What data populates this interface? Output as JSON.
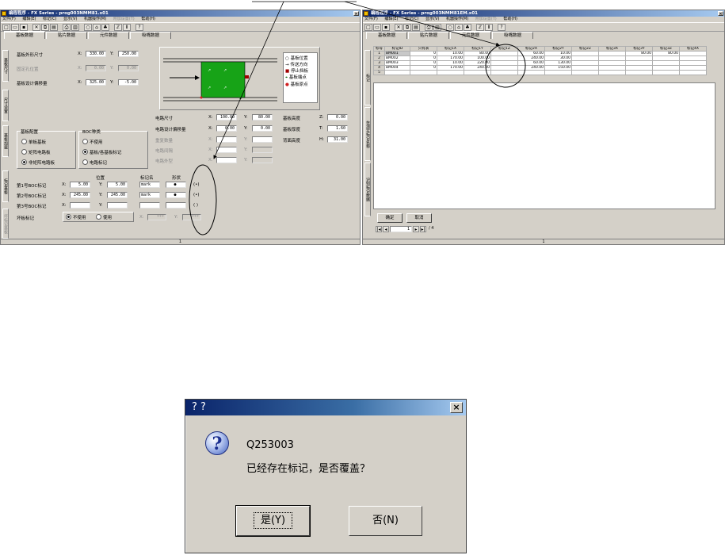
{
  "left_window": {
    "title": "编程程序 - FX Series - prog003NMM81.x01",
    "menu": [
      "文件(F)",
      "编辑(E)",
      "标记(C)",
      "显示(V)",
      "机器操作(M)",
      "附加设置(T)",
      "帮助(H)"
    ],
    "menu_disabled_index": 5,
    "toolbar_icons": [
      "new-icon",
      "open-icon",
      "save-icon",
      "cut-icon",
      "copy-icon",
      "paste-icon",
      "print-icon",
      "preview-icon",
      "bulb-icon",
      "machine-icon",
      "tree-icon",
      "table-icon",
      "grid-icon",
      "help-icon"
    ],
    "tabs": [
      "基板数据",
      "贴片数据",
      "元件数据",
      "吸嘴数据"
    ],
    "vtabs": [
      "基板尺寸",
      "尺寸设置",
      "基板加载",
      "标记基板",
      "坏标记基板"
    ],
    "board_outline_label": "基板外形尺寸",
    "board_outline_x": "330.00",
    "board_outline_y": "250.00",
    "fixed_pos_label": "固定孔位置",
    "fixed_pos_x": "0.00",
    "fixed_pos_y": "0.00",
    "board_offset_label": "基板设计偏移量",
    "board_offset_x": "325.00",
    "board_offset_y": "-5.00",
    "legend": [
      "基板位置",
      "传送方向",
      "停止挡板",
      "基板端点",
      "基板原点"
    ],
    "circuit_size_label": "电路尺寸",
    "circuit_size_x": "100.00",
    "circuit_size_y": "80.00",
    "circuit_offset_label": "电路设计偏移量",
    "circuit_offset_x": "0.00",
    "circuit_offset_y": "0.00",
    "repeat_label": "重复数量",
    "pitch_label": "电路间隔",
    "pattern_label": "电路外型",
    "board_height_label": "基板高度",
    "board_height_value": "0.00",
    "board_thickness_label": "基板厚度",
    "board_thickness_value": "1.60",
    "support_height_label": "背面高度",
    "support_height_value": "31.00",
    "board_config_label": "基板配置",
    "board_config_options": [
      "单板基板",
      "矩阵电路板",
      "非矩阵电路板"
    ],
    "bad_mark_label": "BOC种类",
    "bad_mark_options": [
      "不使用",
      "基板/各基板标记",
      "电路标记"
    ],
    "mark_header_pos": "位置",
    "mark_header_name": "标记名",
    "mark_header_shape": "形状",
    "mark_rows": [
      {
        "label": "第1号BOC标记",
        "x": "5.00",
        "y": "5.00",
        "name": "mark"
      },
      {
        "label": "第2号BOC标记",
        "x": "245.00",
        "y": "245.00",
        "name": "mark"
      },
      {
        "label": "第3号BOC标记",
        "x": "",
        "y": "",
        "name": ""
      }
    ],
    "bad_mark_row_label": "坏板标记",
    "bad_mark_row_options": [
      "不使用",
      "使用"
    ],
    "bad_mark_row_x": "***",
    "bad_mark_row_y": "***",
    "status": "1"
  },
  "right_window": {
    "title": "编程程序 - FX Series - prog003NMM81EM.x01",
    "menu": [
      "文件(F)",
      "编辑(E)",
      "标记(C)",
      "显示(V)",
      "机器操作(M)",
      "附加设置(T)",
      "帮助(H)"
    ],
    "menu_disabled_index": 5,
    "tabs": [
      "基板数据",
      "贴片数据",
      "元件数据",
      "吸嘴数据"
    ],
    "vtabs": [
      "标记",
      "在测定标记名称",
      "识别标记数据"
    ],
    "columns": [
      "标号",
      "标记ID",
      "只有表",
      "标记1X",
      "标记1Y",
      "标记1Z",
      "标记2X",
      "标记2Y",
      "标记2Z",
      "标记3X",
      "标记3Y",
      "标记3Z",
      "标记4X"
    ],
    "rows": [
      [
        "1",
        "BM001",
        "0",
        "10.00",
        "80.00",
        "",
        "60.00",
        "10.00",
        "",
        "",
        "80.00",
        "80.00",
        ""
      ],
      [
        "2",
        "BM002",
        "0",
        "170.00",
        "100.00",
        "",
        "240.00",
        "30.00",
        "",
        "",
        "",
        "",
        ""
      ],
      [
        "3",
        "BM003",
        "0",
        "10.00",
        "220.00",
        "",
        "60.00",
        "130.00",
        "",
        "",
        "",
        "",
        ""
      ],
      [
        "4",
        "BM004",
        "0",
        "170.00",
        "240.00",
        "",
        "240.00",
        "150.00",
        "",
        "",
        "",
        "",
        ""
      ],
      [
        "5",
        "",
        "",
        "",
        "",
        "",
        "",
        "",
        "",
        "",
        "",
        "",
        ""
      ]
    ],
    "ok_label": "确定",
    "cancel_label": "取消",
    "page_value": "1",
    "page_total": "/ 4",
    "status": "1"
  },
  "dialog": {
    "title": "? ?",
    "code": "Q253003",
    "message": "已经存在标记，是否覆盖？",
    "yes_label": "是(Y)",
    "no_label": "否(N)",
    "icon": "question-icon"
  },
  "colors": {
    "titlebar": "#0a246a",
    "board_green": "#17a317",
    "window_bg": "#d4d0c8"
  }
}
